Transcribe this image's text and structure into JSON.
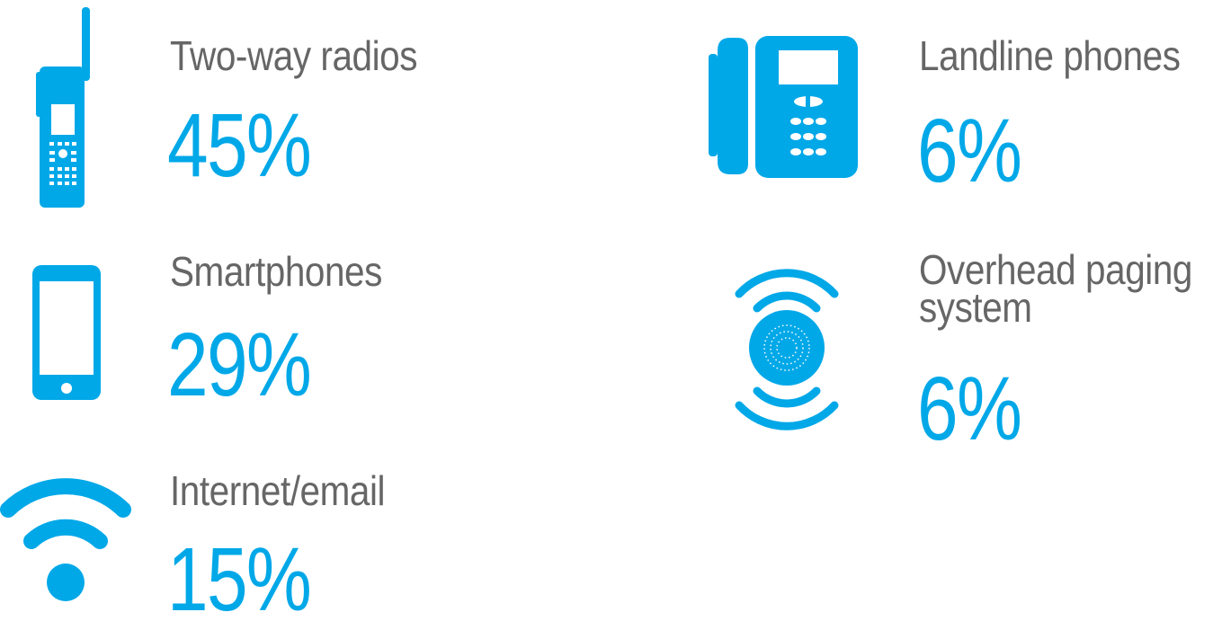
{
  "accent_color": "#00a8e8",
  "label_color": "#666666",
  "stats": [
    {
      "icon": "two-way-radio-icon",
      "label": "Two-way radios",
      "value": "45%"
    },
    {
      "icon": "smartphone-icon",
      "label": "Smartphones",
      "value": "29%"
    },
    {
      "icon": "wifi-icon",
      "label": "Internet/email",
      "value": "15%"
    },
    {
      "icon": "landline-phone-icon",
      "label": "Landline phones",
      "value": "6%"
    },
    {
      "icon": "paging-speaker-icon",
      "label_line1": "Overhead paging",
      "label_line2": "system",
      "value": "6%"
    }
  ]
}
